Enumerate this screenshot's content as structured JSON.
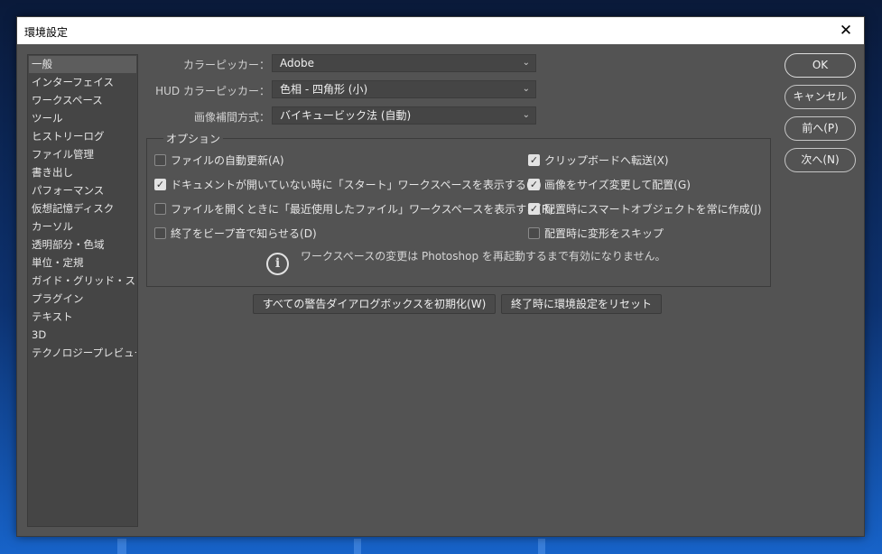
{
  "window": {
    "title": "環境設定",
    "close_glyph": "✕"
  },
  "sidebar": {
    "items": [
      {
        "label": "一般",
        "selected": true
      },
      {
        "label": "インターフェイス"
      },
      {
        "label": "ワークスペース"
      },
      {
        "label": "ツール"
      },
      {
        "label": "ヒストリーログ"
      },
      {
        "label": "ファイル管理"
      },
      {
        "label": "書き出し"
      },
      {
        "label": "パフォーマンス"
      },
      {
        "label": "仮想記憶ディスク"
      },
      {
        "label": "カーソル"
      },
      {
        "label": "透明部分・色域"
      },
      {
        "label": "単位・定規"
      },
      {
        "label": "ガイド・グリッド・スライス"
      },
      {
        "label": "プラグイン"
      },
      {
        "label": "テキスト"
      },
      {
        "label": "3D"
      },
      {
        "label": "テクノロジープレビュー"
      }
    ]
  },
  "general": {
    "color_picker": {
      "label": "カラーピッカー：",
      "value": "Adobe"
    },
    "hud_color_picker": {
      "label": "HUD カラーピッカー：",
      "value": "色相 - 四角形 (小)"
    },
    "interpolation": {
      "label": "画像補間方式：",
      "value": "バイキュービック法 (自動)"
    }
  },
  "options": {
    "title": "オプション",
    "left": [
      {
        "label": "ファイルの自動更新(A)",
        "checked": false
      },
      {
        "label": "ドキュメントが開いていない時に「スタート」ワークスペースを表示する(S)",
        "checked": true
      },
      {
        "label": "ファイルを開くときに「最近使用したファイル」ワークスペースを表示する(R)",
        "checked": false
      },
      {
        "label": "終了をビープ音で知らせる(D)",
        "checked": false
      }
    ],
    "right": [
      {
        "label": "クリップボードへ転送(X)",
        "checked": true
      },
      {
        "label": "画像をサイズ変更して配置(G)",
        "checked": true
      },
      {
        "label": "配置時にスマートオブジェクトを常に作成(J)",
        "checked": true
      },
      {
        "label": "配置時に変形をスキップ",
        "checked": false
      }
    ],
    "info_text": "ワークスペースの変更は Photoshop を再起動するまで有効になりません。",
    "info_icon": "i"
  },
  "buttons": {
    "reset_warnings": "すべての警告ダイアログボックスを初期化(W)",
    "reset_on_quit": "終了時に環境設定をリセット",
    "ok": "OK",
    "cancel": "キャンセル",
    "prev": "前へ(P)",
    "next": "次へ(N)"
  },
  "icons": {
    "dropdown": "chevron-down-icon",
    "check": "check-icon",
    "info": "info-icon",
    "close": "close-icon"
  }
}
